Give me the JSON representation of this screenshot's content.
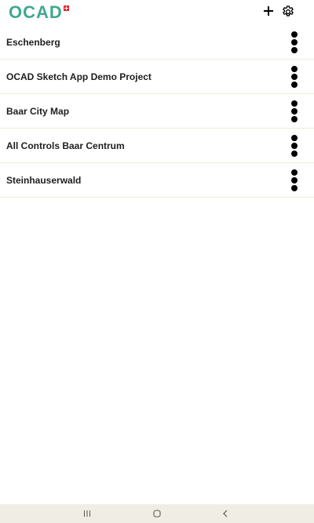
{
  "header": {
    "logo_text": "OCAD",
    "logo_flag_color": "#e3262b",
    "brand_color": "#3fa891",
    "add_icon": "plus-icon",
    "settings_icon": "gear-icon"
  },
  "projects": [
    {
      "name": "Eschenberg",
      "menu_icon": "more-vertical-icon"
    },
    {
      "name": "OCAD Sketch App Demo Project",
      "menu_icon": "more-vertical-icon"
    },
    {
      "name": "Baar City Map",
      "menu_icon": "more-vertical-icon"
    },
    {
      "name": "All Controls Baar Centrum",
      "menu_icon": "more-vertical-icon"
    },
    {
      "name": "Steinhauserwald",
      "menu_icon": "more-vertical-icon"
    }
  ],
  "nav_bar": {
    "recents_icon": "recents-icon",
    "home_icon": "home-icon",
    "back_icon": "back-icon",
    "background": "#f0eee4"
  }
}
